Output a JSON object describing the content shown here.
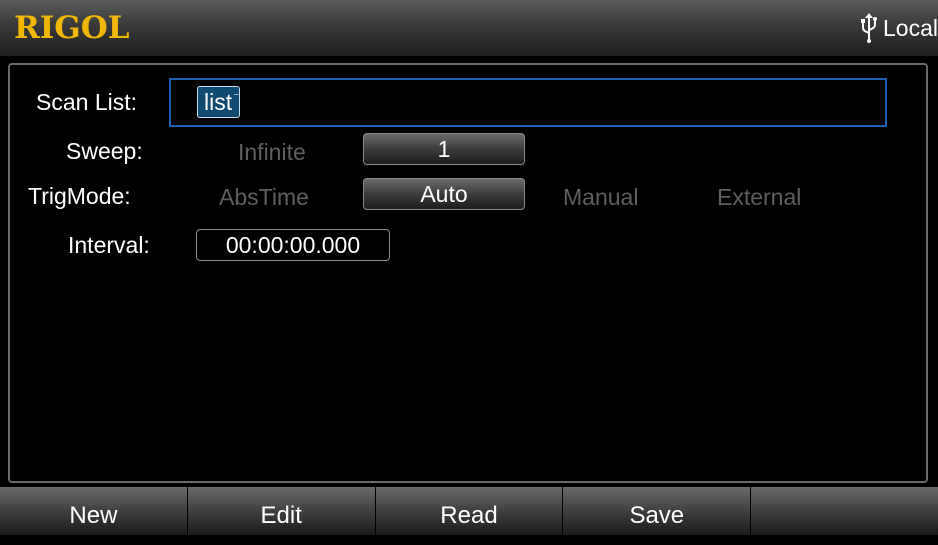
{
  "header": {
    "brand": "RIGOL",
    "interface_icon": "usb-icon",
    "status": "Local",
    "brand_color": "#f2b705"
  },
  "form": {
    "scan_list": {
      "label": "Scan List:",
      "chip": "list",
      "chip_suffix": "..."
    },
    "sweep": {
      "label": "Sweep:",
      "options": [
        "Infinite",
        "1"
      ],
      "selected": "1"
    },
    "trig_mode": {
      "label": "TrigMode:",
      "options": [
        "AbsTime",
        "Auto",
        "Manual",
        "External"
      ],
      "selected": "Auto"
    },
    "interval": {
      "label": "Interval:",
      "value": "00:00:00.000"
    }
  },
  "softkeys": [
    "New",
    "Edit",
    "Read",
    "Save",
    ""
  ],
  "colors": {
    "focus_border": "#1f5fb0",
    "chip_bg": "#114a70",
    "inactive_text": "#5f5f5f"
  }
}
